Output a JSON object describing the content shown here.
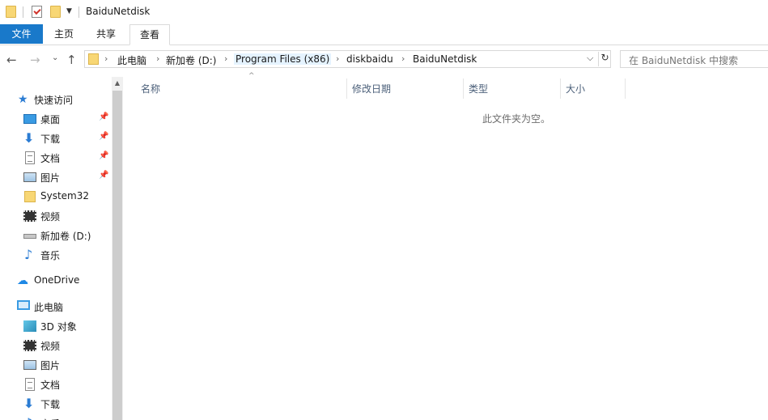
{
  "window": {
    "title": "BaiduNetdisk"
  },
  "ribbon": {
    "tabs": [
      {
        "label": "文件"
      },
      {
        "label": "主页"
      },
      {
        "label": "共享"
      },
      {
        "label": "查看"
      }
    ]
  },
  "address": {
    "crumbs": [
      "此电脑",
      "新加卷 (D:)",
      "Program Files (x86)",
      "diskbaidu",
      "BaiduNetdisk"
    ]
  },
  "search": {
    "placeholder": "在 BaiduNetdisk 中搜索"
  },
  "sidebar": {
    "quick_access": "快速访问",
    "items": [
      {
        "label": "桌面",
        "icon": "desktop-icon",
        "pinned": true
      },
      {
        "label": "下载",
        "icon": "download-icon",
        "pinned": true
      },
      {
        "label": "文档",
        "icon": "documents-icon",
        "pinned": true
      },
      {
        "label": "图片",
        "icon": "pictures-icon",
        "pinned": true
      },
      {
        "label": "System32",
        "icon": "folder-icon",
        "pinned": false
      },
      {
        "label": "视频",
        "icon": "videos-icon",
        "pinned": false
      },
      {
        "label": "新加卷 (D:)",
        "icon": "drive-icon",
        "pinned": false
      },
      {
        "label": "音乐",
        "icon": "music-icon",
        "pinned": false
      }
    ],
    "onedrive": "OneDrive",
    "this_pc": "此电脑",
    "pc_items": [
      {
        "label": "3D 对象",
        "icon": "3d-objects-icon"
      },
      {
        "label": "视频",
        "icon": "videos-icon"
      },
      {
        "label": "图片",
        "icon": "pictures-icon"
      },
      {
        "label": "文档",
        "icon": "documents-icon"
      },
      {
        "label": "下载",
        "icon": "download-icon"
      },
      {
        "label": "音乐",
        "icon": "music-icon"
      }
    ]
  },
  "columns": [
    {
      "label": "名称"
    },
    {
      "label": "修改日期"
    },
    {
      "label": "类型"
    },
    {
      "label": "大小"
    }
  ],
  "content": {
    "empty_message": "此文件夹为空。"
  }
}
